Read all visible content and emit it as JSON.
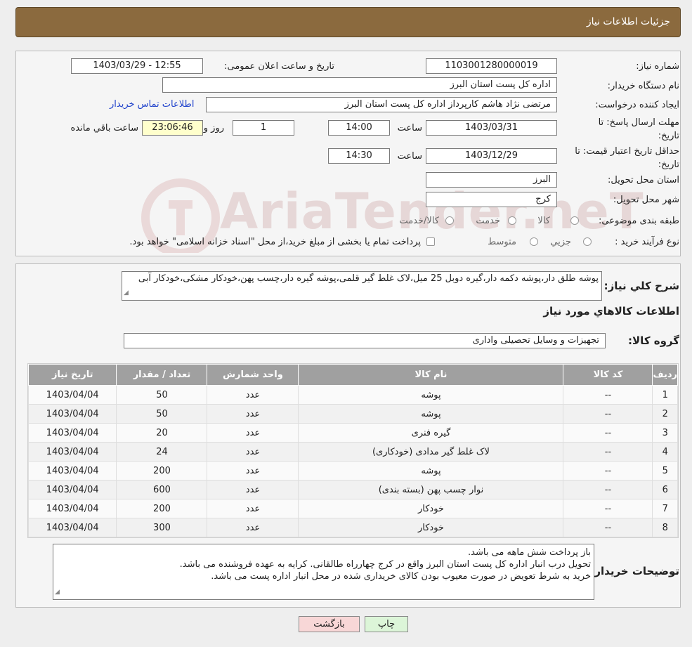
{
  "header": {
    "title": "جزئیات اطلاعات نیاز"
  },
  "form": {
    "need_number_label": "شماره نیاز:",
    "need_number": "1103001280000019",
    "announce_label": "تاریخ و ساعت اعلان عمومی:",
    "announce_value": "1403/03/29 - 12:55",
    "buyer_org_label": "نام دستگاه خریدار:",
    "buyer_org": "اداره کل پست استان البرز",
    "requester_label": "ایجاد کننده درخواست:",
    "requester": "مرتضی  نژاد هاشم کارپرداز اداره کل پست استان البرز",
    "contact_link": "اطلاعات تماس خریدار",
    "reply_deadline_label_1": "مهلت ارسال پاسخ: تا",
    "reply_deadline_label_2": "تاریخ:",
    "reply_date": "1403/03/31",
    "time_label": "ساعت",
    "reply_time": "14:00",
    "days_value": "1",
    "days_label": "روز و",
    "remaining_time": "23:06:46",
    "remaining_label": "ساعت باقي مانده",
    "price_validity_label_1": "حداقل تاریخ اعتبار قیمت: تا",
    "price_validity_label_2": "تاریخ:",
    "price_date": "1403/12/29",
    "price_time": "14:30",
    "province_label": "استان محل تحویل:",
    "province": "البرز",
    "city_label": "شهر محل تحویل:",
    "city": "کرج",
    "category_label": "طبقه بندی موضوعی:",
    "category_options": [
      "کالا",
      "خدمت",
      "کالا/خدمت"
    ],
    "purchase_type_label": "نوع فرآیند خرید :",
    "purchase_options": [
      "جزیي",
      "متوسط"
    ],
    "purchase_note": "پرداخت تمام یا بخشی از مبلغ خرید،از محل \"اسناد خزانه اسلامی\" خواهد بود."
  },
  "description": {
    "label": "شرح کلي نیاز:",
    "text": "پوشه طلق دار،پوشه دکمه دار،گیره دوبل 25 میل،لاک غلط گیر قلمی،پوشه گیره دار،چسب پهن،خودکار مشکی،خودکار آبی"
  },
  "goods": {
    "section_title": "اطلاعات کالاهاي مورد نیاز",
    "group_label": "گروه کالا:",
    "group_value": "تجهیزات و وسایل تحصیلی واداری",
    "columns": [
      "ردیف",
      "کد کالا",
      "نام کالا",
      "واحد شمارش",
      "تعداد / مقدار",
      "تاریخ نیاز"
    ],
    "rows": [
      [
        "1",
        "--",
        "پوشه",
        "عدد",
        "50",
        "1403/04/04"
      ],
      [
        "2",
        "--",
        "پوشه",
        "عدد",
        "50",
        "1403/04/04"
      ],
      [
        "3",
        "--",
        "گیره فنری",
        "عدد",
        "20",
        "1403/04/04"
      ],
      [
        "4",
        "--",
        "لاک غلط گیر مدادی (خودکاری)",
        "عدد",
        "24",
        "1403/04/04"
      ],
      [
        "5",
        "--",
        "پوشه",
        "عدد",
        "200",
        "1403/04/04"
      ],
      [
        "6",
        "--",
        "نوار چسب پهن (بسته بندی)",
        "عدد",
        "600",
        "1403/04/04"
      ],
      [
        "7",
        "--",
        "خودکار",
        "عدد",
        "200",
        "1403/04/04"
      ],
      [
        "8",
        "--",
        "خودکار",
        "عدد",
        "300",
        "1403/04/04"
      ]
    ]
  },
  "buyer_notes": {
    "label": "توضیحات خریدار:",
    "lines": [
      "باز پرداخت شش ماهه می باشد.",
      "تحویل درب انبار اداره کل پست استان البرز واقع در کرج چهارراه طالقانی. کرایه به عهده فروشنده می باشد.",
      "خرید به شرط تعویض در صورت معیوب بودن کالای خریداری شده در محل انبار اداره پست می باشد."
    ]
  },
  "actions": {
    "print": "چاپ",
    "back": "بازگشت"
  },
  "watermark": "AriaTender.neT",
  "colors": {
    "title_bar": "#8b6a3e",
    "table_header": "#a0a0a0",
    "back_button": "#f8d7d7",
    "print_button": "#dcf5d8",
    "link": "#2244cc"
  }
}
